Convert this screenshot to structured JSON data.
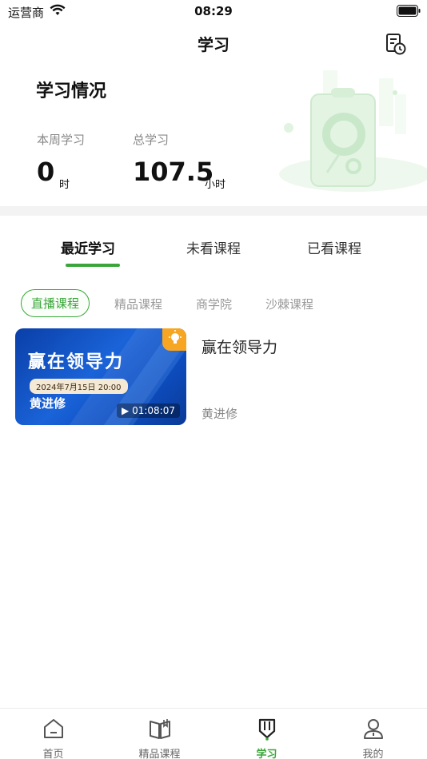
{
  "status": {
    "carrier": "运营商",
    "time": "08:29"
  },
  "nav": {
    "title": "学习",
    "history_icon": "history-icon"
  },
  "summary": {
    "title": "学习情况",
    "week_label": "本周学习",
    "week_value": "0",
    "week_unit": "时",
    "total_label": "总学习",
    "total_value": "107.5",
    "total_unit": "小时"
  },
  "main_tabs": [
    "最近学习",
    "未看课程",
    "已看课程"
  ],
  "sub_tabs": [
    "直播课程",
    "精品课程",
    "商学院",
    "沙棘课程"
  ],
  "course": {
    "thumb_title": "赢在领导力",
    "thumb_date": "2024年7月15日 20:00",
    "thumb_speaker": "黄进修",
    "duration": "01:08:07",
    "title": "赢在领导力",
    "teacher": "黄进修"
  },
  "tabbar": [
    {
      "label": "首页",
      "icon": "home-icon"
    },
    {
      "label": "精品课程",
      "icon": "book-icon"
    },
    {
      "label": "学习",
      "icon": "study-icon"
    },
    {
      "label": "我的",
      "icon": "profile-icon"
    }
  ],
  "colors": {
    "accent": "#3aa63a",
    "thumb_blue": "#1a63d8",
    "badge_orange": "#f6a623"
  }
}
